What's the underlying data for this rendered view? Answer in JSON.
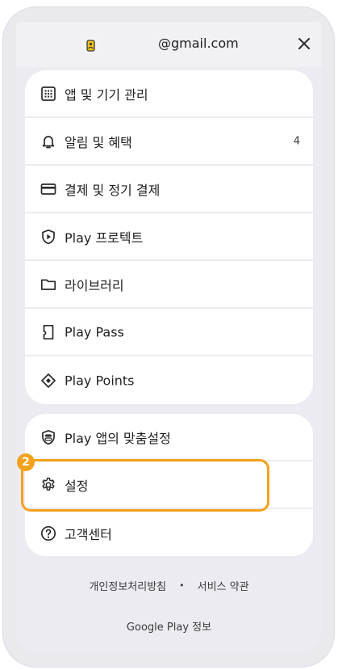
{
  "header": {
    "email": "@gmail.com",
    "avatar_icon": "user-avatar-icon",
    "close_icon": "close-icon"
  },
  "menu_primary": [
    {
      "icon": "apps-grid-icon",
      "label": "앱 및 기기 관리",
      "badge": ""
    },
    {
      "icon": "bell-icon",
      "label": "알림 및 혜택",
      "badge": "4"
    },
    {
      "icon": "credit-card-icon",
      "label": "결제 및 정기 결제",
      "badge": ""
    },
    {
      "icon": "shield-play-icon",
      "label": "Play 프로텍트",
      "badge": ""
    },
    {
      "icon": "folder-icon",
      "label": "라이브러리",
      "badge": ""
    },
    {
      "icon": "bookmark-ticket-icon",
      "label": "Play Pass",
      "badge": ""
    },
    {
      "icon": "diamond-icon",
      "label": "Play Points",
      "badge": ""
    }
  ],
  "menu_secondary": [
    {
      "icon": "shield-toggle-icon",
      "label": "Play 앱의 맞춤설정"
    },
    {
      "icon": "gear-icon",
      "label": "설정"
    },
    {
      "icon": "help-circle-icon",
      "label": "고객센터"
    }
  ],
  "annotation": {
    "step_number": "2",
    "highlight_color": "#f4a11d"
  },
  "footer": {
    "privacy_link": "개인정보처리방침",
    "separator": "•",
    "terms_link": "서비스 약관",
    "about_link": "Google Play 정보"
  },
  "colors": {
    "background": "#ebebf1",
    "card": "#ffffff",
    "text": "#1f1f1f"
  }
}
